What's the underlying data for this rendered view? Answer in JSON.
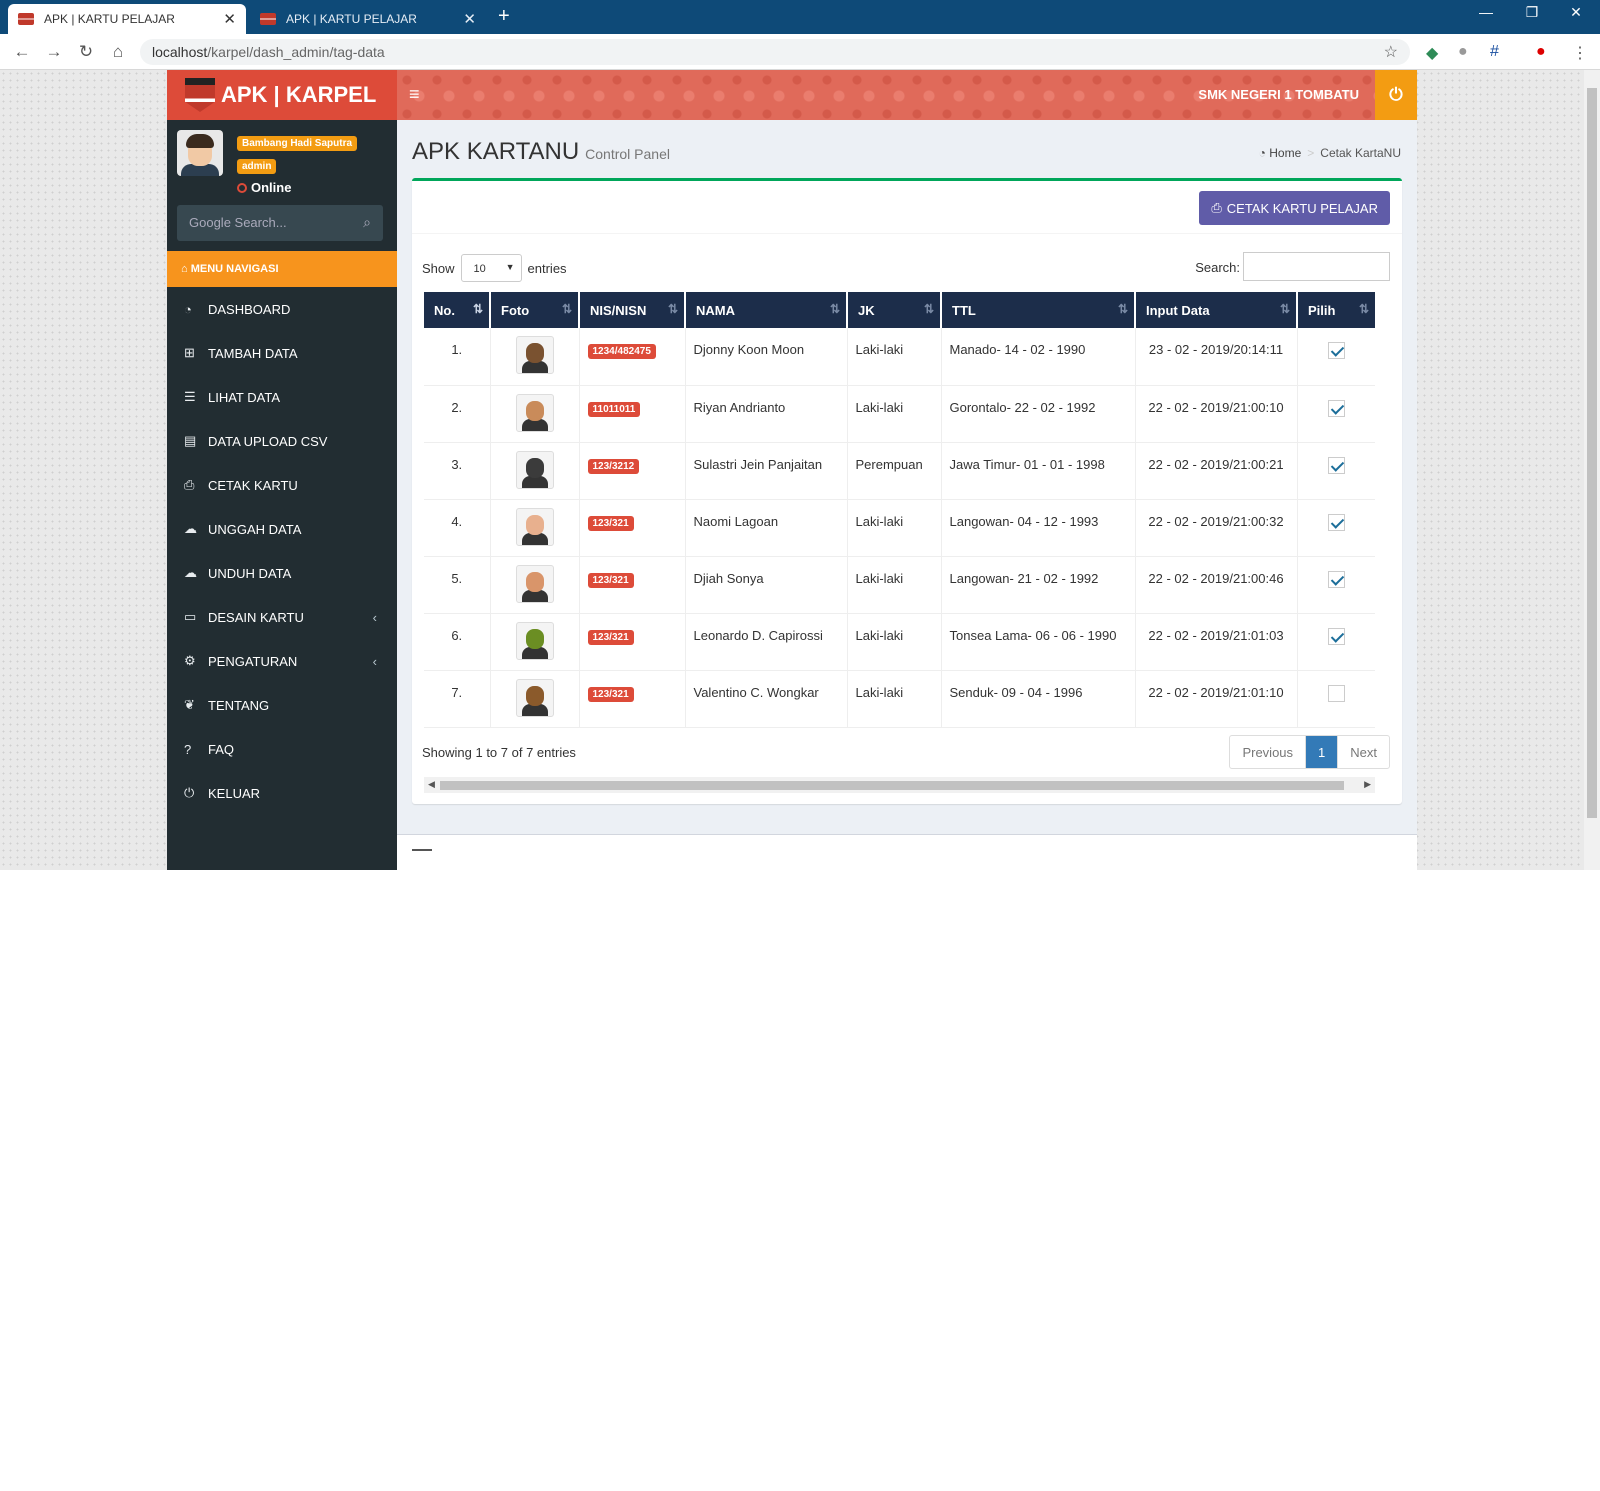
{
  "browser": {
    "tabs": [
      {
        "title": "APK | KARTU PELAJAR",
        "active": true
      },
      {
        "title": "APK | KARTU PELAJAR",
        "active": false
      }
    ],
    "url_host": "localhost",
    "url_path": "/karpel/dash_admin/tag-data"
  },
  "header": {
    "logo_text": "APK | KARPEL",
    "school_name": "SMK NEGERI 1 TOMBATU"
  },
  "user": {
    "name": "Bambang Hadi Saputra",
    "role": "admin",
    "status": "Online"
  },
  "sidebar": {
    "search_placeholder": "Google Search...",
    "menu_header": "MENU NAVIGASI",
    "items": [
      {
        "label": "DASHBOARD",
        "icon": "dashboard-icon"
      },
      {
        "label": "TAMBAH DATA",
        "icon": "plus-square-icon"
      },
      {
        "label": "LIHAT DATA",
        "icon": "list-icon"
      },
      {
        "label": "DATA UPLOAD CSV",
        "icon": "table-icon"
      },
      {
        "label": "CETAK KARTU",
        "icon": "print-icon"
      },
      {
        "label": "UNGGAH DATA",
        "icon": "cloud-upload-icon"
      },
      {
        "label": "UNDUH DATA",
        "icon": "cloud-download-icon"
      },
      {
        "label": "DESAIN KARTU",
        "icon": "credit-card-icon"
      },
      {
        "label": "PENGATURAN",
        "icon": "cogs-icon"
      },
      {
        "label": "TENTANG",
        "icon": "leaf-icon"
      },
      {
        "label": "FAQ",
        "icon": "question-circle-icon"
      },
      {
        "label": "KELUAR",
        "icon": "power-icon"
      }
    ]
  },
  "content": {
    "title": "APK KARTANU",
    "subtitle": "Control Panel",
    "breadcrumb": {
      "home": "Home",
      "current": "Cetak KartaNU"
    },
    "print_button": "CETAK KARTU PELAJAR",
    "show_label": "Show",
    "entries_value": "10",
    "entries_label": "entries",
    "search_label": "Search:",
    "columns": [
      "No.",
      "Foto",
      "NIS/NISN",
      "NAMA",
      "JK",
      "TTL",
      "Input Data",
      "Pilih"
    ],
    "rows": [
      {
        "no": "1.",
        "nis": "1234/482475",
        "nama": "Djonny Koon Moon",
        "jk": "Laki-laki",
        "ttl": "Manado- 14 - 02 - 1990",
        "input": "23 - 02 - 2019/20:14:11",
        "checked": true
      },
      {
        "no": "2.",
        "nis": "11011011",
        "nama": "Riyan Andrianto",
        "jk": "Laki-laki",
        "ttl": "Gorontalo- 22 - 02 - 1992",
        "input": "22 - 02 - 2019/21:00:10",
        "checked": true
      },
      {
        "no": "3.",
        "nis": "123/3212",
        "nama": "Sulastri Jein Panjaitan",
        "jk": "Perempuan",
        "ttl": "Jawa Timur- 01 - 01 - 1998",
        "input": "22 - 02 - 2019/21:00:21",
        "checked": true
      },
      {
        "no": "4.",
        "nis": "123/321",
        "nama": "Naomi Lagoan",
        "jk": "Laki-laki",
        "ttl": "Langowan- 04 - 12 - 1993",
        "input": "22 - 02 - 2019/21:00:32",
        "checked": true
      },
      {
        "no": "5.",
        "nis": "123/321",
        "nama": "Djiah Sonya",
        "jk": "Laki-laki",
        "ttl": "Langowan- 21 - 02 - 1992",
        "input": "22 - 02 - 2019/21:00:46",
        "checked": true
      },
      {
        "no": "6.",
        "nis": "123/321",
        "nama": "Leonardo D. Capirossi",
        "jk": "Laki-laki",
        "ttl": "Tonsea Lama- 06 - 06 - 1990",
        "input": "22 - 02 - 2019/21:01:03",
        "checked": true
      },
      {
        "no": "7.",
        "nis": "123/321",
        "nama": "Valentino C. Wongkar",
        "jk": "Laki-laki",
        "ttl": "Senduk- 09 - 04 - 1996",
        "input": "22 - 02 - 2019/21:01:10",
        "checked": false
      }
    ],
    "info": "Showing 1 to 7 of 7 entries",
    "pagination": {
      "previous": "Previous",
      "page": "1",
      "next": "Next"
    }
  },
  "colors": {
    "logo_bg": "#dd4b39",
    "power_bg": "#f39c12",
    "sidebar_bg": "#222d32",
    "menu_header_bg": "#f7941d",
    "table_header_bg": "#1c2d4a",
    "print_button_bg": "#605ca8",
    "box_border_top": "#00a65a",
    "nis_label_bg": "#dd4b39"
  }
}
